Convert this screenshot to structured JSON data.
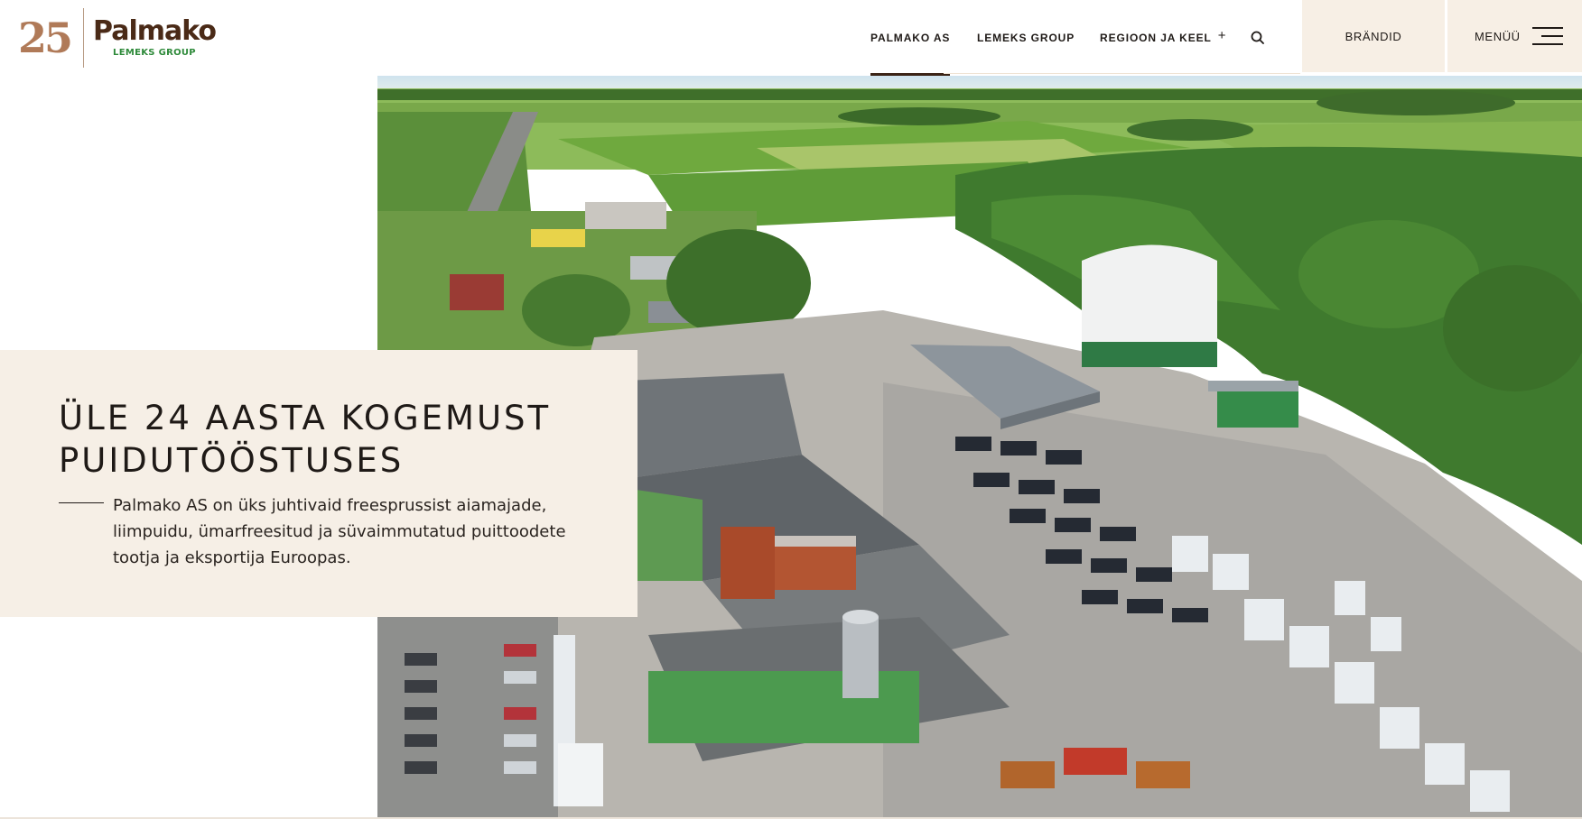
{
  "logo": {
    "anniversary_number": "25",
    "brand_name": "Palmako",
    "group_name": "LEMEKS GROUP"
  },
  "nav": {
    "items": [
      {
        "label": "PALMAKO AS",
        "active": true
      },
      {
        "label": "LEMEKS GROUP",
        "active": false
      },
      {
        "label": "REGIOON JA KEEL",
        "active": false,
        "has_plus": true
      }
    ],
    "plus_symbol": "+",
    "search_icon": "search-icon"
  },
  "header_buttons": {
    "brands_label": "BRÄNDID",
    "menu_label": "MENÜÜ",
    "menu_icon": "hamburger-icon"
  },
  "hero": {
    "title_line1": "ÜLE 24 AASTA KOGEMUST",
    "title_line2": "PUIDUTÖÖSTUSES",
    "description": "Palmako AS on üks juhtivaid freesprussist aiamajade, liimpuidu, ümarfreesitud ja süvaimmutatud puittoodete tootja ja eksportija Euroopas.",
    "image_subject": "aerial photo of Palmako factory site"
  },
  "colors": {
    "accent_dark": "#3b2416",
    "logo_brown": "#4a2a17",
    "logo_gold": "#b07a58",
    "group_green": "#2e8a3a",
    "panel_beige": "#f6efe6",
    "button_beige": "#f7efe5"
  }
}
